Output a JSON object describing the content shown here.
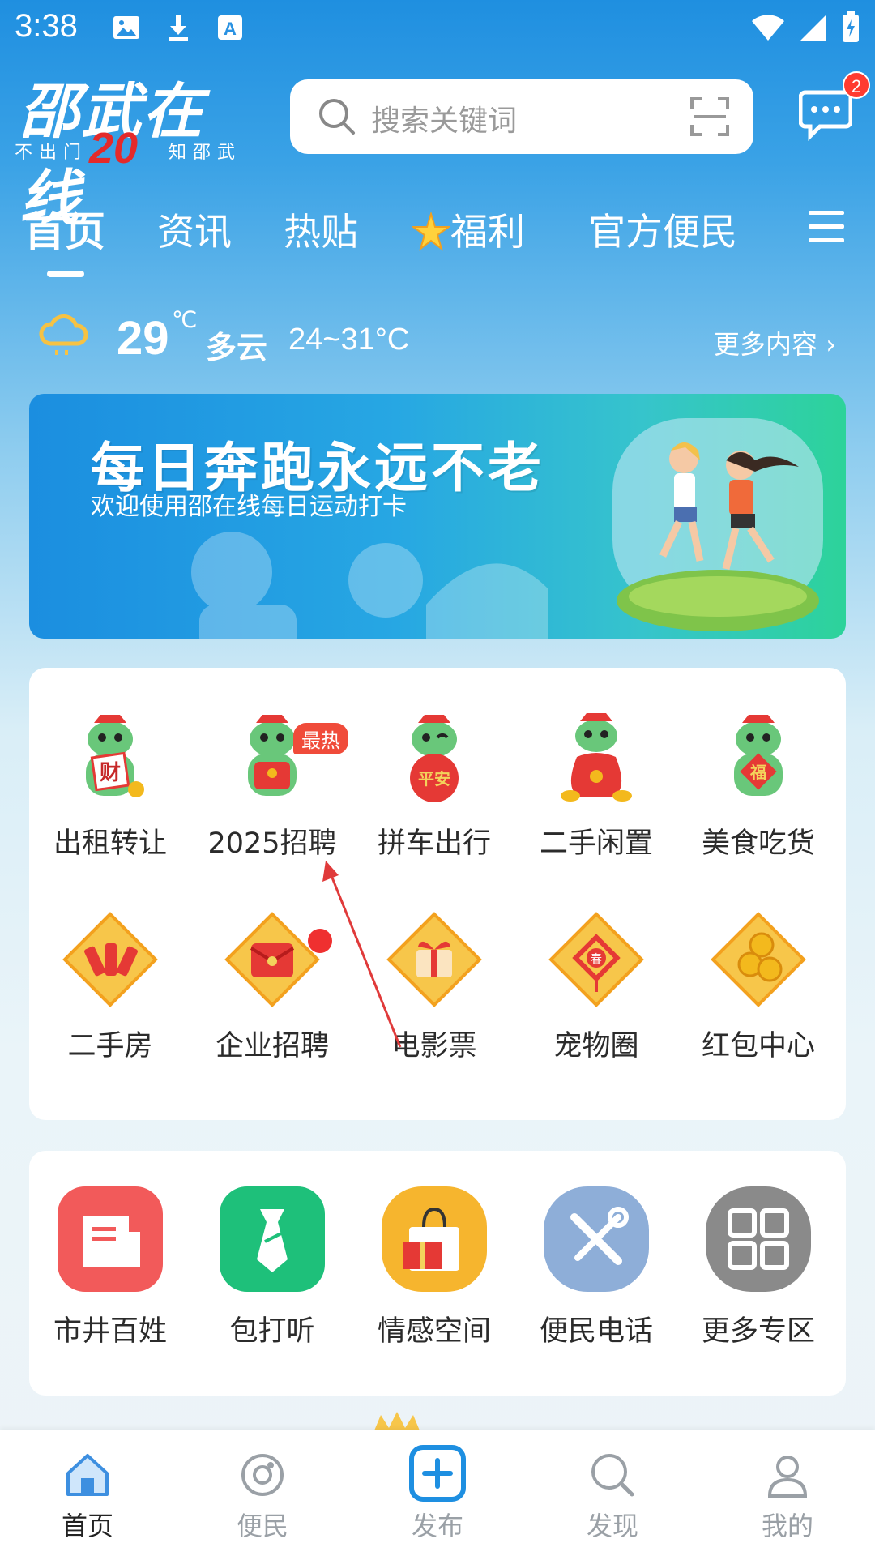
{
  "status_bar": {
    "time": "3:38"
  },
  "header": {
    "logo_title": "邵武在线",
    "logo_sub_left": "不出门",
    "logo_year": "20",
    "logo_sub_right": "知邵武",
    "search_placeholder": "搜索关键词",
    "message_badge": "2"
  },
  "tabs": [
    {
      "label": "首页",
      "active": true
    },
    {
      "label": "资讯"
    },
    {
      "label": "热贴"
    },
    {
      "label": "福利"
    },
    {
      "label": "官方便民"
    }
  ],
  "weather": {
    "temp": "29",
    "unit": "℃",
    "desc": "多云",
    "range": "24~31°C",
    "more": "更多内容 ›"
  },
  "banner": {
    "title": "每日奔跑永远不老",
    "subtitle": "欢迎使用邵在线每日运动打卡"
  },
  "grid_row1": [
    {
      "label": "出租转让",
      "icon": "mascot-cai-icon"
    },
    {
      "label": "2025招聘",
      "icon": "mascot-redpacket-icon",
      "badge": "最热"
    },
    {
      "label": "拼车出行",
      "icon": "mascot-pingan-icon"
    },
    {
      "label": "二手闲置",
      "icon": "mascot-moneybag-icon"
    },
    {
      "label": "美食吃货",
      "icon": "mascot-fu-icon"
    }
  ],
  "grid_row2": [
    {
      "label": "二手房",
      "icon": "firecracker-icon"
    },
    {
      "label": "企业招聘",
      "icon": "red-envelope-icon"
    },
    {
      "label": "电影票",
      "icon": "gift-icon"
    },
    {
      "label": "宠物圈",
      "icon": "chinese-knot-icon"
    },
    {
      "label": "红包中心",
      "icon": "gold-coins-icon"
    }
  ],
  "grid_row3": [
    {
      "label": "市井百姓",
      "icon": "building-icon",
      "color": "#f25a5a"
    },
    {
      "label": "包打听",
      "icon": "tie-icon",
      "color": "#1ec07a"
    },
    {
      "label": "情感空间",
      "icon": "gift-bag-icon",
      "color": "#f6b52e"
    },
    {
      "label": "便民电话",
      "icon": "tools-icon",
      "color": "#8eaed8"
    },
    {
      "label": "更多专区",
      "icon": "grid-icon",
      "color": "#8a8a8a"
    }
  ],
  "bottom_nav": [
    {
      "label": "首页",
      "active": true
    },
    {
      "label": "便民"
    },
    {
      "label": "发布"
    },
    {
      "label": "发现"
    },
    {
      "label": "我的"
    }
  ],
  "colors": {
    "accent": "#1e8fe1",
    "tab_text": "#ffffff",
    "badge_red": "#ff3b30"
  }
}
